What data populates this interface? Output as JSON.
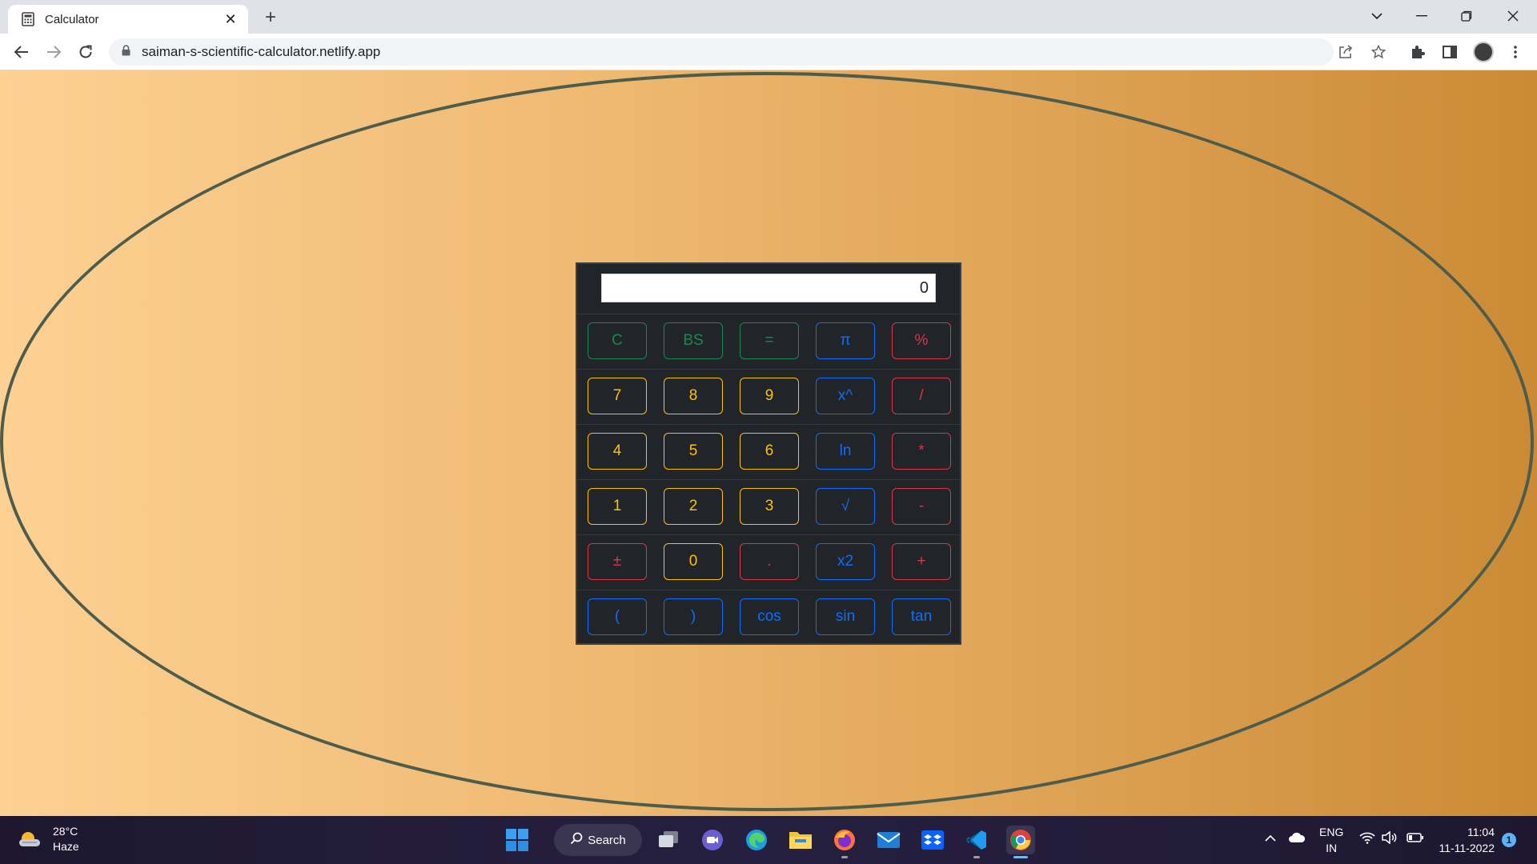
{
  "browser": {
    "tab_title": "Calculator",
    "url": "saiman-s-scientific-calculator.netlify.app"
  },
  "calculator": {
    "display_value": "0",
    "rows": [
      [
        {
          "label": "C",
          "color": "green"
        },
        {
          "label": "BS",
          "color": "green"
        },
        {
          "label": "=",
          "color": "green"
        },
        {
          "label": "π",
          "color": "blue"
        },
        {
          "label": "%",
          "color": "red"
        }
      ],
      [
        {
          "label": "7",
          "color": "yellow"
        },
        {
          "label": "8",
          "color": "yellow"
        },
        {
          "label": "9",
          "color": "yellow"
        },
        {
          "label": "x^",
          "color": "blue"
        },
        {
          "label": "/",
          "color": "red"
        }
      ],
      [
        {
          "label": "4",
          "color": "yellow"
        },
        {
          "label": "5",
          "color": "yellow"
        },
        {
          "label": "6",
          "color": "yellow"
        },
        {
          "label": "ln",
          "color": "blue"
        },
        {
          "label": "*",
          "color": "red"
        }
      ],
      [
        {
          "label": "1",
          "color": "yellow"
        },
        {
          "label": "2",
          "color": "yellow"
        },
        {
          "label": "3",
          "color": "yellow"
        },
        {
          "label": "√",
          "color": "blue"
        },
        {
          "label": "-",
          "color": "red"
        }
      ],
      [
        {
          "label": "±",
          "color": "red"
        },
        {
          "label": "0",
          "color": "yellow"
        },
        {
          "label": ".",
          "color": "red"
        },
        {
          "label": "x2",
          "color": "blue"
        },
        {
          "label": "+",
          "color": "red"
        }
      ],
      [
        {
          "label": "(",
          "color": "blue"
        },
        {
          "label": ")",
          "color": "blue"
        },
        {
          "label": "cos",
          "color": "blue"
        },
        {
          "label": "sin",
          "color": "blue"
        },
        {
          "label": "tan",
          "color": "blue"
        }
      ]
    ]
  },
  "colors": {
    "green": "#198754",
    "yellow": "#ffc107",
    "blue": "#0d6efd",
    "red": "#dc3545",
    "page_gradient_start": "#fdd193",
    "page_gradient_end": "#cb8a35",
    "oval_border": "#4c5d4d"
  },
  "taskbar": {
    "temperature": "28°C",
    "condition": "Haze",
    "search_label": "Search",
    "lang_top": "ENG",
    "lang_bottom": "IN",
    "time": "11:04",
    "date": "11-11-2022",
    "notification_count": "1"
  }
}
